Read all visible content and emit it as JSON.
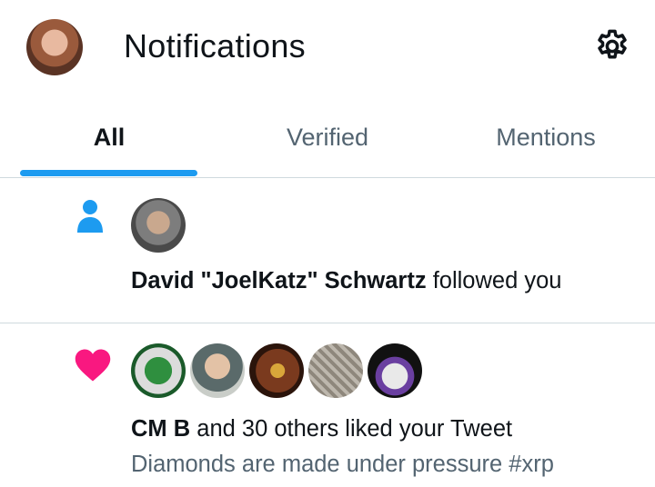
{
  "header": {
    "title": "Notifications",
    "profile_avatar": "profile-avatar",
    "settings_icon": "gear-icon"
  },
  "tabs": [
    {
      "label": "All",
      "active": true
    },
    {
      "label": "Verified",
      "active": false
    },
    {
      "label": "Mentions",
      "active": false
    }
  ],
  "colors": {
    "accent": "#1d9bf0",
    "like": "#f91880",
    "text_primary": "#0f1419",
    "text_secondary": "#536471",
    "divider": "#cfd9de"
  },
  "notifications": [
    {
      "type": "follow",
      "icon": "person-icon",
      "actor": "David \"JoelKatz\" Schwartz",
      "action": " followed you"
    },
    {
      "type": "like",
      "icon": "heart-icon",
      "actor": "CM B",
      "action": " and 30 others liked your Tweet",
      "tweet_text": "Diamonds are made under pressure #xrp"
    }
  ]
}
